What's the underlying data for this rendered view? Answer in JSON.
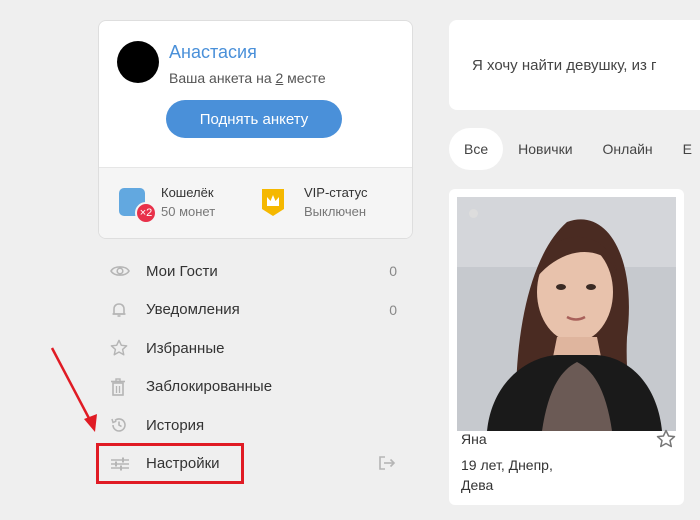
{
  "profile": {
    "name": "Анастасия",
    "rank_prefix": "Ваша анкета на ",
    "rank_number": "2",
    "rank_suffix": " месте",
    "raise_button": "Поднять анкету"
  },
  "wallet": {
    "title": "Кошелёк",
    "subtitle": "50 монет",
    "badge": "×2",
    "icon": "wallet-icon"
  },
  "vip": {
    "title": "VIP-статус",
    "subtitle": "Выключен",
    "icon": "crown-icon"
  },
  "menu": {
    "items": [
      {
        "label": "Мои Гости",
        "count": "0",
        "icon": "eye-icon"
      },
      {
        "label": "Уведомления",
        "count": "0",
        "icon": "bell-icon"
      },
      {
        "label": "Избранные",
        "count": "",
        "icon": "star-icon"
      },
      {
        "label": "Заблокированные",
        "count": "",
        "icon": "trash-icon"
      },
      {
        "label": "История",
        "count": "",
        "icon": "history-icon"
      },
      {
        "label": "Настройки",
        "count": "",
        "icon": "sliders-icon"
      }
    ]
  },
  "search": {
    "text": "Я хочу найти девушку, из г"
  },
  "tabs": [
    "Все",
    "Новички",
    "Онлайн",
    "Е"
  ],
  "active_tab": "Все",
  "card": {
    "name": "Яна",
    "info": "19 лет, Днепр, Дева"
  },
  "colors": {
    "accent": "#4a90d9",
    "highlight": "#e01b24",
    "badge": "#e8314a",
    "vip": "#f5b800"
  }
}
